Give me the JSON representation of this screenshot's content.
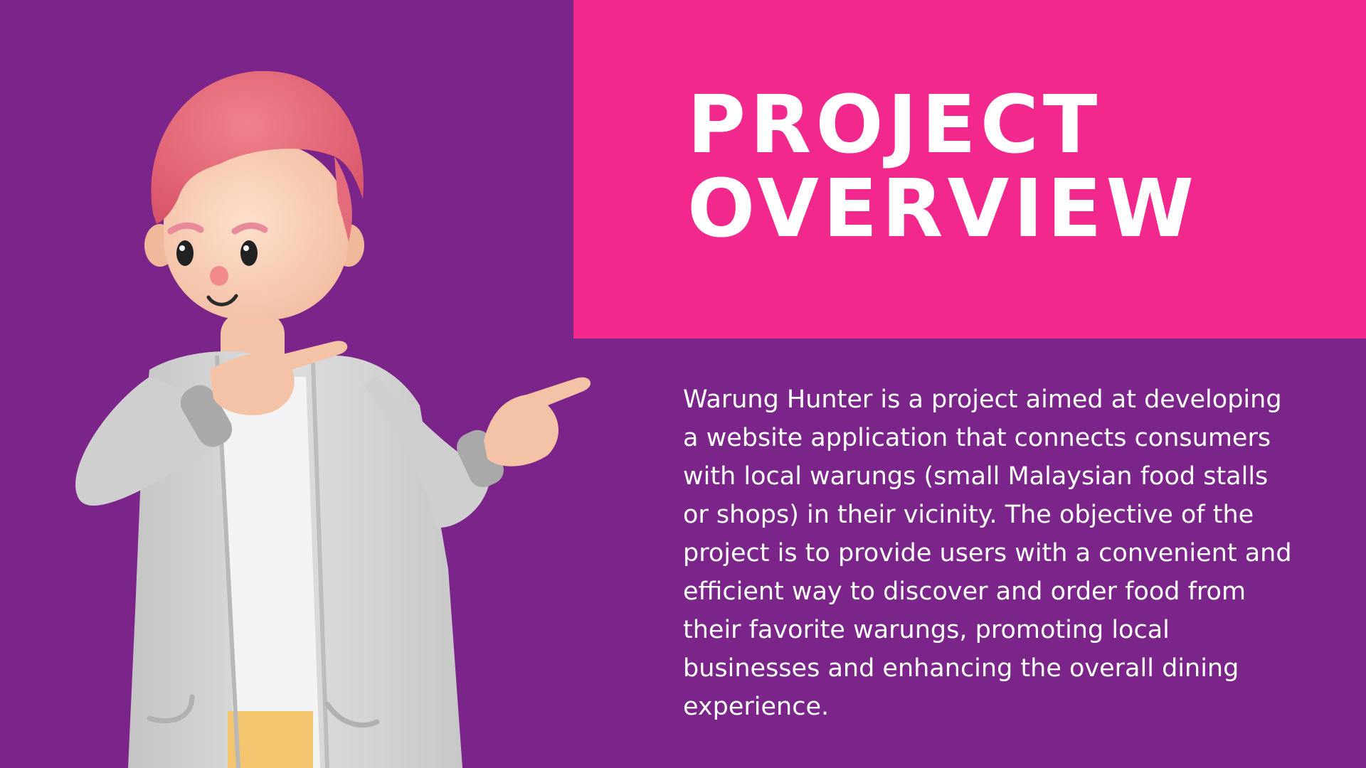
{
  "slide": {
    "title_line1": "PROJECT",
    "title_line2": "OVERVIEW",
    "body": "Warung Hunter is a project aimed at developing a website application that connects consumers with local warungs (small Malaysian food stalls or shops) in their vicinity. The objective of the project is to provide users with a convenient and efficient way to discover and order food from their favorite warungs, promoting local businesses and enhancing the overall dining experience."
  },
  "colors": {
    "background": "#7b2489",
    "title_panel": "#f2288c",
    "text": "#ffffff"
  },
  "illustration": {
    "icon": "3d-pointing-character-illustration"
  }
}
